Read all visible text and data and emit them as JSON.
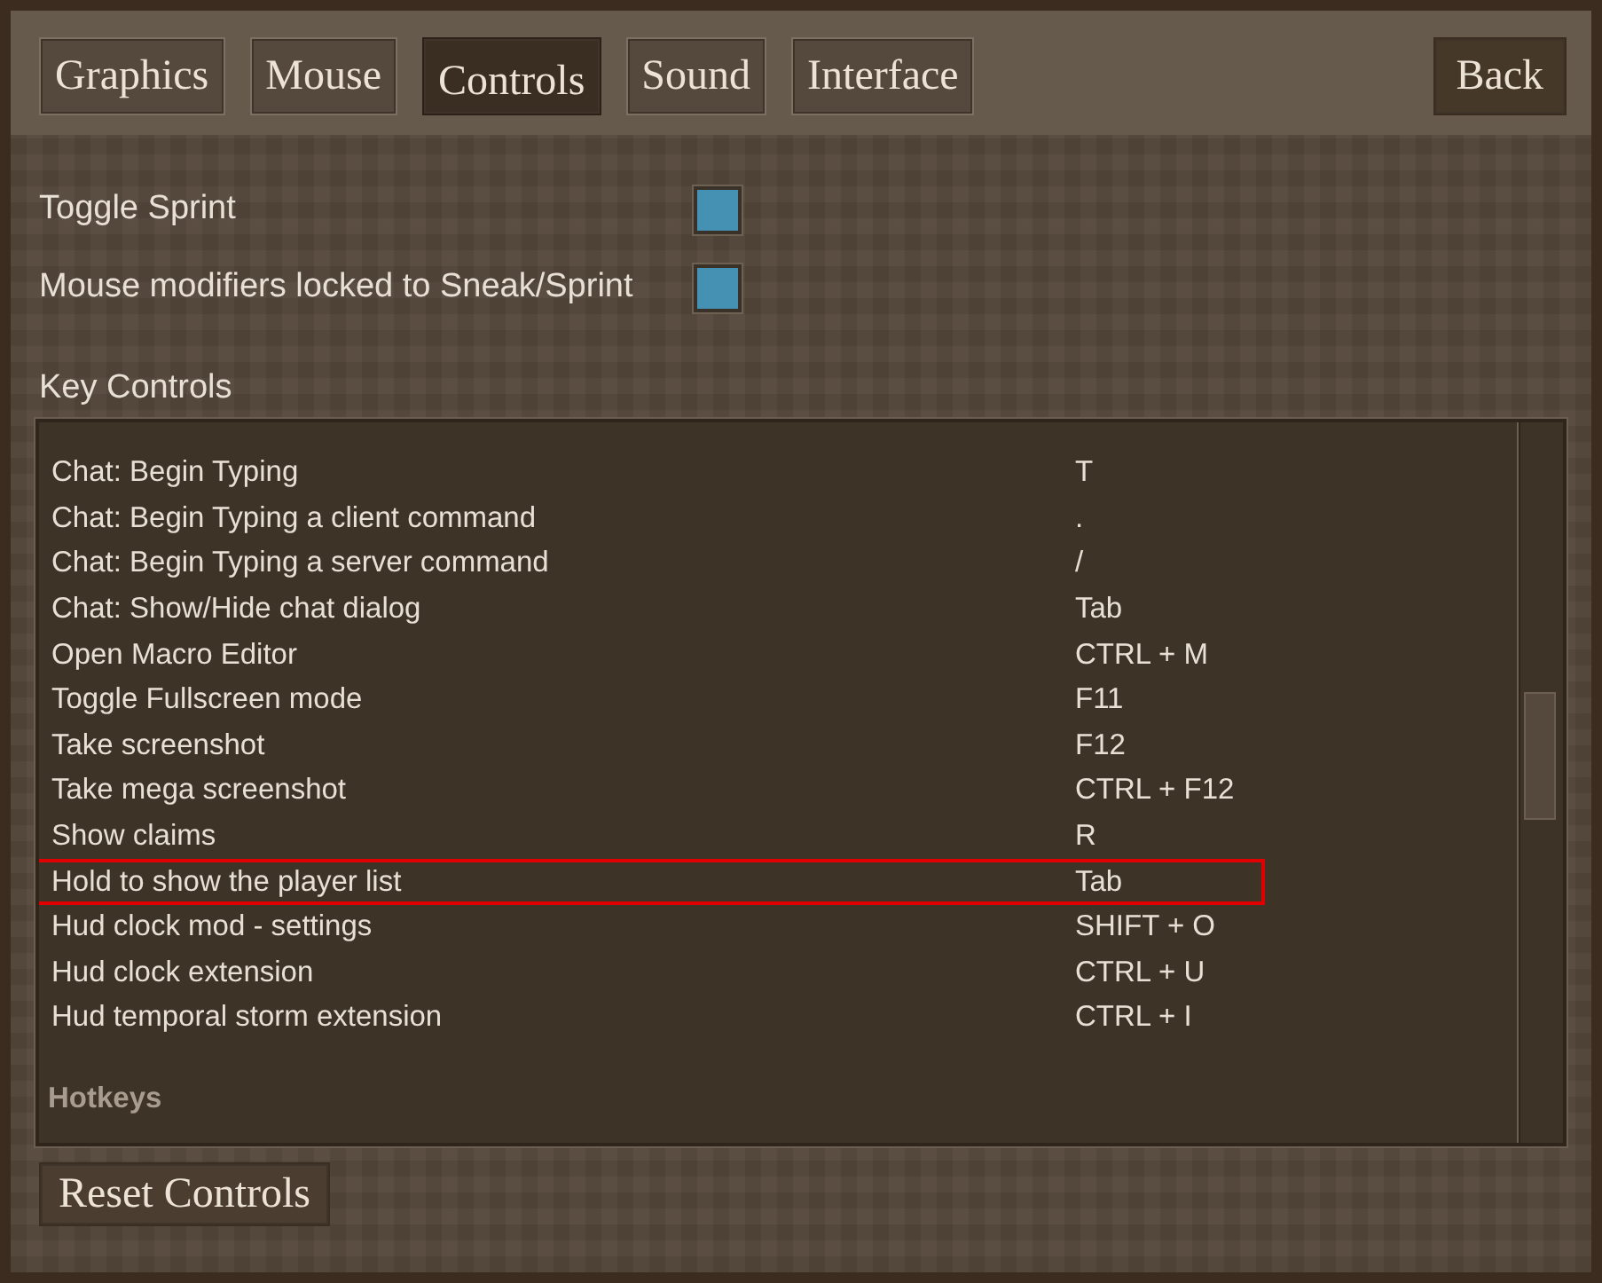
{
  "tabs": [
    {
      "label": "Graphics",
      "selected": false
    },
    {
      "label": "Mouse",
      "selected": false
    },
    {
      "label": "Controls",
      "selected": true
    },
    {
      "label": "Sound",
      "selected": false
    },
    {
      "label": "Interface",
      "selected": false
    }
  ],
  "back_button": "Back",
  "toggles": [
    {
      "label": "Toggle Sprint",
      "checked": true
    },
    {
      "label": "Mouse modifiers locked to Sneak/Sprint",
      "checked": true
    }
  ],
  "key_controls": {
    "title": "Key Controls",
    "items": [
      {
        "kind": "row",
        "action": "Chat: Begin Typing",
        "key": "T",
        "highlighted": false
      },
      {
        "kind": "row",
        "action": "Chat: Begin Typing a client command",
        "key": ".",
        "highlighted": false
      },
      {
        "kind": "row",
        "action": "Chat: Begin Typing a server command",
        "key": "/",
        "highlighted": false
      },
      {
        "kind": "row",
        "action": "Chat: Show/Hide chat dialog",
        "key": "Tab",
        "highlighted": false
      },
      {
        "kind": "row",
        "action": "Open Macro Editor",
        "key": "CTRL + M",
        "highlighted": false
      },
      {
        "kind": "row",
        "action": "Toggle Fullscreen mode",
        "key": "F11",
        "highlighted": false
      },
      {
        "kind": "row",
        "action": "Take screenshot",
        "key": "F12",
        "highlighted": false
      },
      {
        "kind": "row",
        "action": "Take mega screenshot",
        "key": "CTRL + F12",
        "highlighted": false
      },
      {
        "kind": "row",
        "action": "Show claims",
        "key": "R",
        "highlighted": false
      },
      {
        "kind": "row",
        "action": "Hold to show the player list",
        "key": "Tab",
        "highlighted": true
      },
      {
        "kind": "row",
        "action": "Hud clock mod - settings",
        "key": "SHIFT + O",
        "highlighted": false
      },
      {
        "kind": "row",
        "action": "Hud clock extension",
        "key": "CTRL + U",
        "highlighted": false
      },
      {
        "kind": "row",
        "action": "Hud temporal storm extension",
        "key": "CTRL + I",
        "highlighted": false
      },
      {
        "kind": "header",
        "action": "Hotkeys"
      }
    ]
  },
  "reset_button": "Reset Controls"
}
